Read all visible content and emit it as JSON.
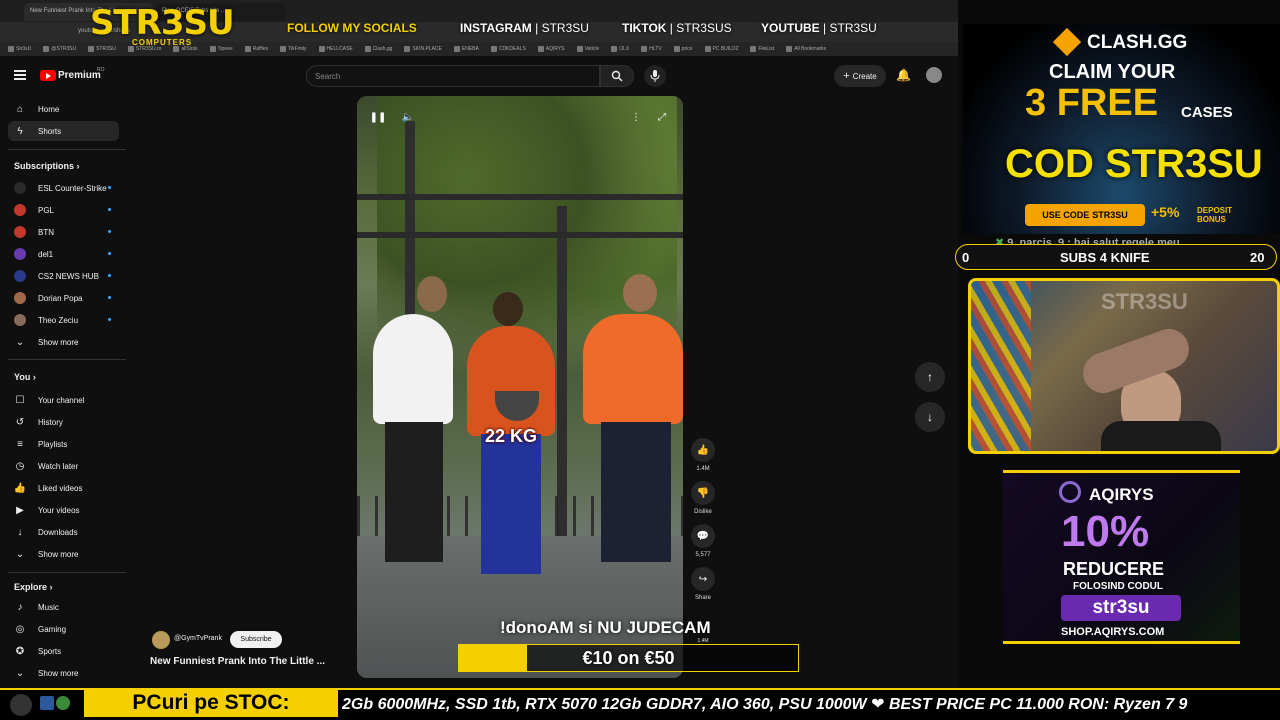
{
  "browser": {
    "tabs": [
      "New Funniest Prank Into The Li...",
      "Plan OCEIF Tabs site ..."
    ],
    "address": "youtube.com/shorts",
    "bookmarks": [
      "Str3sU",
      "@STR3SU",
      "STR3SU",
      "STR3SU.ro",
      "allSlots",
      "Tipeee",
      "Raffles",
      "TikFinity",
      "HELLCASE",
      "Clash.gg",
      "SKIN.PLACE",
      "ENEBA",
      "CDKDEALS",
      "AQIRYS",
      "Vaticle",
      "OLX",
      "HLTV",
      "price",
      "PC BUILD2",
      "FileList",
      "All Bookmarks"
    ]
  },
  "youtube": {
    "logo": "Premium",
    "logo_badge": "RO",
    "search_placeholder": "Search",
    "create_label": "Create",
    "nav": [
      {
        "label": "Home",
        "icon": "home-icon"
      },
      {
        "label": "Shorts",
        "icon": "shorts-icon"
      }
    ],
    "subscriptions_title": "Subscriptions",
    "subscriptions": [
      {
        "label": "ESL Counter-Strike",
        "color": "#2a2a2a"
      },
      {
        "label": "PGL",
        "color": "#c0392b"
      },
      {
        "label": "BTN",
        "color": "#c0392b"
      },
      {
        "label": "del1",
        "color": "#6a3ab0"
      },
      {
        "label": "CS2 NEWS HUB",
        "color": "#2a3a8a"
      },
      {
        "label": "Dorian Popa",
        "color": "#a06a4a"
      },
      {
        "label": "Theo Zeciu",
        "color": "#8a6a5a"
      }
    ],
    "show_more": "Show more",
    "you_title": "You",
    "you_items": [
      {
        "label": "Your channel",
        "icon": "channel-icon"
      },
      {
        "label": "History",
        "icon": "history-icon"
      },
      {
        "label": "Playlists",
        "icon": "playlists-icon"
      },
      {
        "label": "Watch later",
        "icon": "watch-later-icon"
      },
      {
        "label": "Liked videos",
        "icon": "like-icon"
      },
      {
        "label": "Your videos",
        "icon": "your-videos-icon"
      },
      {
        "label": "Downloads",
        "icon": "download-icon"
      }
    ],
    "explore_title": "Explore",
    "explore_items": [
      {
        "label": "Music",
        "icon": "music-icon"
      },
      {
        "label": "Gaming",
        "icon": "gaming-icon"
      },
      {
        "label": "Sports",
        "icon": "sports-icon"
      }
    ],
    "short": {
      "channel": "@GymTvPrank",
      "subscribe": "Subscribe",
      "title": "New Funniest Prank Into The Little ...",
      "caption": "22 KG",
      "likes": "1.4M",
      "dislike": "Dislike",
      "comments": "5,577",
      "share": "Share",
      "remix": "1.4M"
    }
  },
  "overlay": {
    "logo": "STR3SU",
    "logo_sub": "COMPUTERS",
    "follow": "FOLLOW MY SOCIALS",
    "socials": [
      {
        "platform": "INSTAGRAM",
        "handle": "STR3SU"
      },
      {
        "platform": "TIKTOK",
        "handle": "STR3SUS"
      },
      {
        "platform": "YOUTUBE",
        "handle": "STR3SU"
      }
    ],
    "clash": {
      "brand": "CLASH.GG",
      "line1": "CLAIM YOUR",
      "line2_big": "3 FREE",
      "line2_small": "CASES",
      "code": "COD STR3SU",
      "use_code": "USE CODE",
      "use_code_value": "STR3SU",
      "bonus": "+5%",
      "bonus_label": "DEPOSIT BONUS"
    },
    "chat_line": "9_narcis_9 : hai salut regele meu",
    "subs_goal": {
      "left": "0",
      "label": "SUBS 4 KNIFE",
      "right": "20"
    },
    "cam_label": "STR3SU",
    "aqirys": {
      "brand": "AQIRYS",
      "percent": "10%",
      "reducere": "REDUCERE",
      "folosind": "FOLOSIND CODUL",
      "code": "str3su",
      "site": "SHOP.AQIRYS.COM"
    },
    "dono_text": "!donoAM si NU JUDECAM",
    "dono_goal": "€10 on €50",
    "dono_progress": 0.2,
    "ticker_label": "PCuri pe STOC:",
    "ticker_text": "2Gb 6000MHz, SSD 1tb, RTX 5070 12Gb GDDR7, AIO 360, PSU 1000W  ❤ BEST PRICE PC 11.000 RON: Ryzen 7 9"
  }
}
